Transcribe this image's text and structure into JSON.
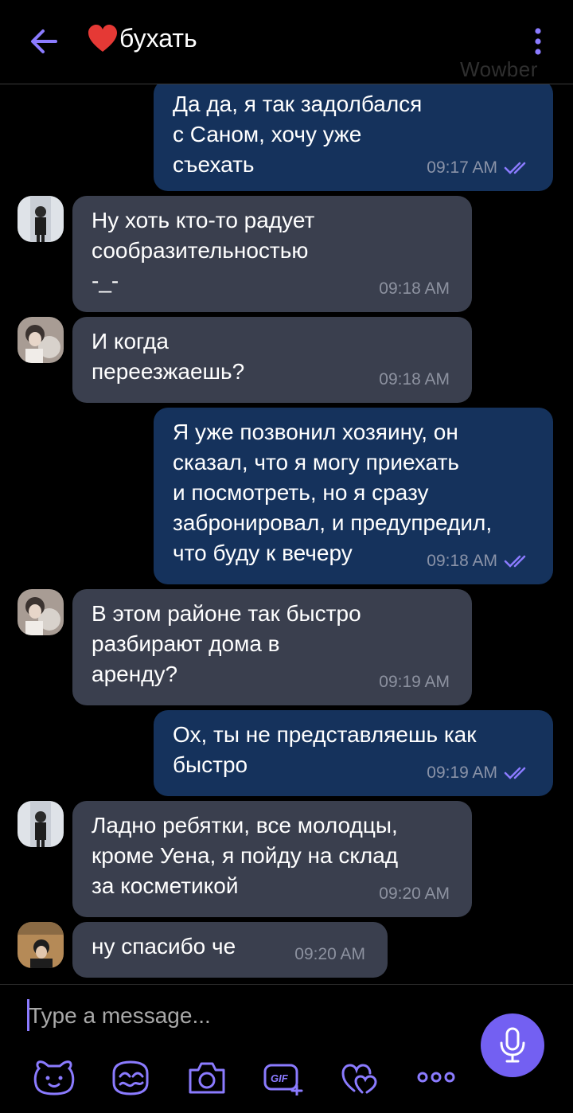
{
  "header": {
    "title": "бухать",
    "watermark": "Wowber",
    "back_icon": "arrow-left-icon",
    "menu_icon": "more-vertical-icon"
  },
  "messages": [
    {
      "direction": "out",
      "text": "Да да, я так задолбался\nс Саном, хочу уже\nсъехать",
      "time": "09:17 AM",
      "read": true
    },
    {
      "direction": "in",
      "avatar": "avatar-1",
      "text": "Ну хоть кто-то радует\nсообразительностью\n-_-",
      "time": "09:18 AM"
    },
    {
      "direction": "in",
      "avatar": "avatar-2",
      "text": "И когда\nпереезжаешь?",
      "time": "09:18 AM"
    },
    {
      "direction": "out",
      "text": "Я уже позвонил хозяину, он\nсказал, что я могу приехать\nи посмотреть, но я сразу\nзабронировал, и предупредил,\nчто буду к вечеру",
      "time": "09:18 AM",
      "read": true
    },
    {
      "direction": "in",
      "avatar": "avatar-2",
      "text": "В этом районе так быстро\nразбирают дома в\nаренду?",
      "time": "09:19 AM"
    },
    {
      "direction": "out",
      "text": "Ох, ты не представляешь как\nбыстро",
      "time": "09:19 AM",
      "read": true
    },
    {
      "direction": "in",
      "avatar": "avatar-1",
      "text": "Ладно ребятки, все молодцы,\nкроме Уена, я пойду на склад\nза косметикой",
      "time": "09:20 AM"
    },
    {
      "direction": "in",
      "avatar": "avatar-3",
      "text": "ну спасибо че",
      "time": "09:20 AM"
    }
  ],
  "composer": {
    "placeholder": "Type a message...",
    "toolbar": [
      "sticker-icon",
      "doodle-icon",
      "camera-icon",
      "gif-icon",
      "heart-gift-icon",
      "more-icon"
    ],
    "mic_icon": "microphone-icon"
  },
  "colors": {
    "outgoing_bubble": "#15325c",
    "incoming_bubble": "#3a3f4e",
    "accent": "#7360f2"
  }
}
